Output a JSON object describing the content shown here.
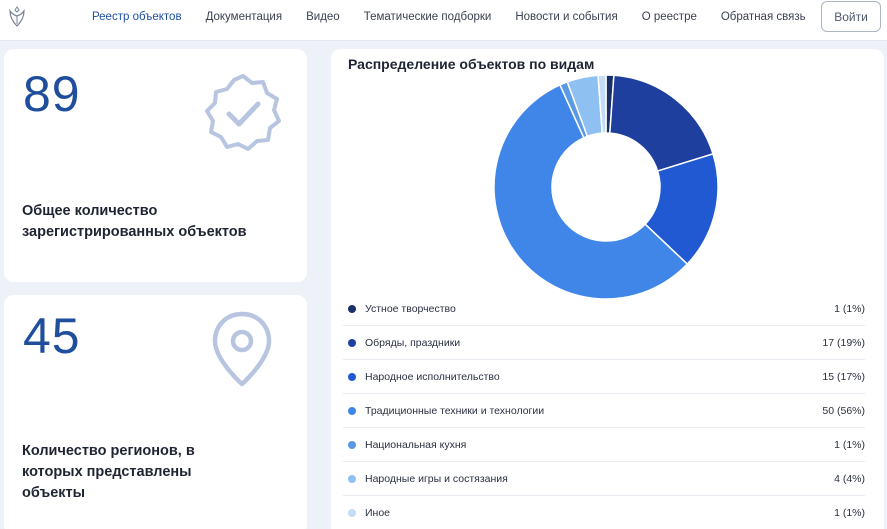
{
  "header": {
    "logo_icon": "emblem-icon",
    "nav": [
      {
        "label": "Реестр объектов",
        "active": true
      },
      {
        "label": "Документация",
        "active": false
      },
      {
        "label": "Видео",
        "active": false
      },
      {
        "label": "Тематические подборки",
        "active": false
      },
      {
        "label": "Новости и события",
        "active": false
      },
      {
        "label": "О реестре",
        "active": false
      },
      {
        "label": "Обратная связь",
        "active": false
      }
    ],
    "login_label": "Войти"
  },
  "stats": [
    {
      "value": "89",
      "icon": "badge-check-icon",
      "label": "Общее количество зарегистрированных объектов"
    },
    {
      "value": "45",
      "icon": "map-pin-icon",
      "label": "Количество регионов, в которых представлены объекты"
    }
  ],
  "colors": {
    "accent": "#1d4ea3",
    "number": "#1f4f9c",
    "icon": "#b8c5e0"
  },
  "chart_data": {
    "type": "pie",
    "title": "Распределение объектов по видам",
    "donut": true,
    "series": [
      {
        "name": "Устное творчество",
        "value": 1,
        "label": "1 (1%)",
        "color": "#1b2f6b"
      },
      {
        "name": "Обряды, праздники",
        "value": 17,
        "label": "17 (19%)",
        "color": "#1e3f9e"
      },
      {
        "name": "Народное исполнительство",
        "value": 15,
        "label": "15 (17%)",
        "color": "#2059d1"
      },
      {
        "name": "Традиционные техники и технологии",
        "value": 50,
        "label": "50 (56%)",
        "color": "#3f86e8"
      },
      {
        "name": "Национальная кухня",
        "value": 1,
        "label": "1 (1%)",
        "color": "#5a9ae4"
      },
      {
        "name": "Народные игры и состязания",
        "value": 4,
        "label": "4 (4%)",
        "color": "#8fc0f2"
      },
      {
        "name": "Иное",
        "value": 1,
        "label": "1 (1%)",
        "color": "#c3dcf7"
      }
    ]
  }
}
